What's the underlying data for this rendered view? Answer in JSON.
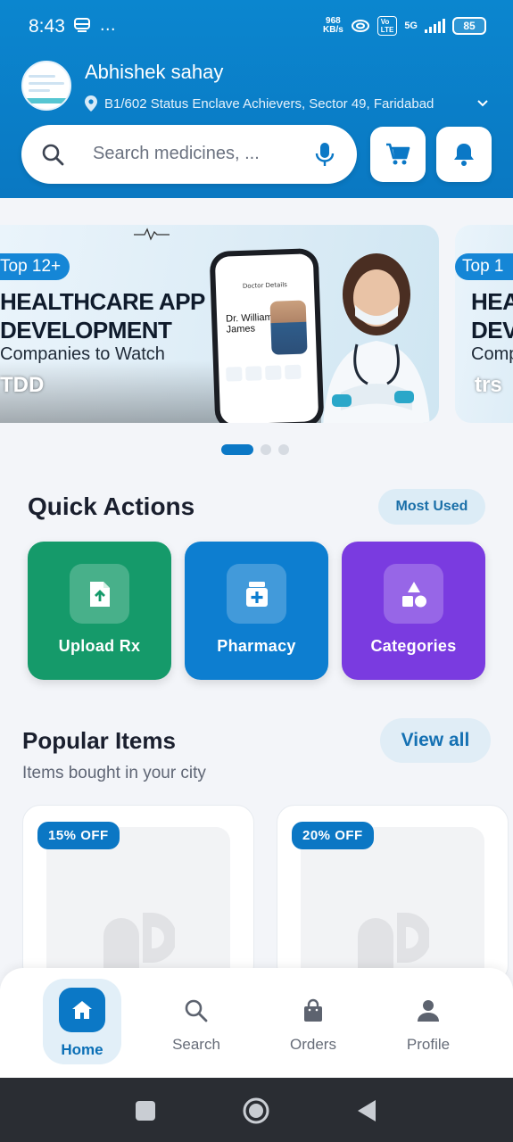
{
  "status_bar": {
    "time": "8:43",
    "left_icons": "…",
    "net_speed_value": "968",
    "net_speed_unit": "KB/s",
    "volte": "Vo\nLTE",
    "network": "5G",
    "battery": "85"
  },
  "header": {
    "user_name": "Abhishek sahay",
    "address": "B1/602 Status Enclave Achievers, Sector 49, Faridabad",
    "search_placeholder": "Search medicines, ..."
  },
  "banners": [
    {
      "tag": "Top 12+",
      "title_line1": "HEALTHCARE APP",
      "title_line2": "DEVELOPMENT",
      "subtitle": "Companies to Watch",
      "overlay_text": "TDD",
      "phone_screen_title": "Doctor Details",
      "phone_doctor_name": "Dr. William James"
    },
    {
      "tag": "Top 1",
      "title_line1": "HEA",
      "title_line2": "DEV",
      "subtitle": "Comp",
      "overlay_text": "trs"
    }
  ],
  "quick_actions": {
    "title": "Quick Actions",
    "badge": "Most Used",
    "items": [
      {
        "label": "Upload Rx",
        "color": "#159a6a",
        "icon": "upload-file-icon"
      },
      {
        "label": "Pharmacy",
        "color": "#0d7ed0",
        "icon": "pharmacy-bottle-icon"
      },
      {
        "label": "Categories",
        "color": "#7a3be0",
        "icon": "shapes-icon"
      }
    ]
  },
  "popular_items": {
    "title": "Popular Items",
    "subtitle": "Items bought in your city",
    "view_all": "View all",
    "products": [
      {
        "discount": "15% OFF"
      },
      {
        "discount": "20% OFF"
      }
    ]
  },
  "bottom_nav": {
    "items": [
      {
        "label": "Home",
        "icon": "home-icon",
        "active": true
      },
      {
        "label": "Search",
        "icon": "search-icon",
        "active": false
      },
      {
        "label": "Orders",
        "icon": "shopping-bag-icon",
        "active": false
      },
      {
        "label": "Profile",
        "icon": "person-icon",
        "active": false
      }
    ]
  },
  "colors": {
    "primary": "#0b78c6",
    "header": "#0a7fca",
    "upload": "#159a6a",
    "pharmacy": "#0d7ed0",
    "categories": "#7a3be0"
  }
}
